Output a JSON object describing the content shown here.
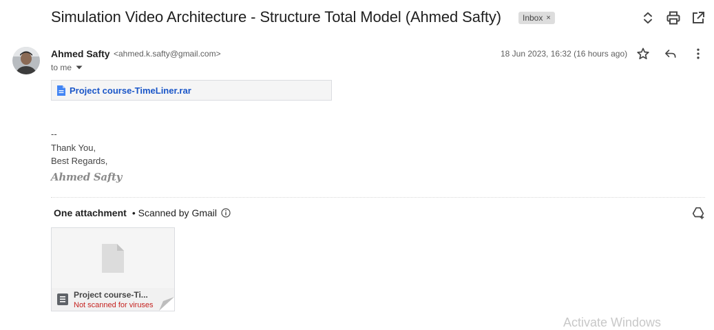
{
  "email": {
    "subject": "Simulation Video Architecture - Structure Total Model (Ahmed Safty)",
    "label_badge": "Inbox",
    "badge_close": "×",
    "sender_name": "Ahmed Safty",
    "sender_email": "<ahmed.k.safty@gmail.com>",
    "recipient_line": "to me",
    "date": "18 Jun 2023, 16:32 (16 hours ago)"
  },
  "body": {
    "inline_attachment_name": "Project course-TimeLiner.rar",
    "signature_separator": "--",
    "closing_line_1": "Thank You,",
    "closing_line_2": "Best Regards,",
    "signature_name": "Ahmed Safty"
  },
  "attachments": {
    "heading": "One attachment",
    "scan_status": "• Scanned by Gmail",
    "items": [
      {
        "name": "Project course-Ti...",
        "status": "Not scanned for viruses"
      }
    ]
  },
  "watermark": "Activate Windows",
  "icons": {
    "expand": "unfold-more-icon",
    "print": "print-icon",
    "open_new": "open-in-new-icon",
    "star": "star-icon",
    "reply": "reply-icon",
    "more": "more-vert-icon",
    "info": "info-icon",
    "add_to_drive": "add-to-drive-icon",
    "file": "file-icon",
    "archive": "archive-file-icon"
  },
  "colors": {
    "link_blue": "#1a56c8",
    "file_icon_blue": "#4285f4",
    "warning_red": "#c5221f",
    "badge_bg": "#dddddd"
  }
}
